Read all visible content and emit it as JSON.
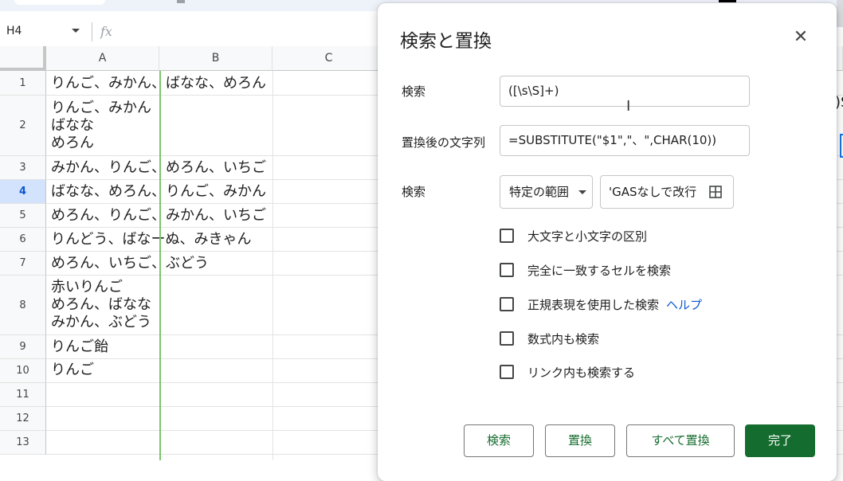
{
  "formula_bar": {
    "cell_ref": "H4",
    "fx_label": "fx"
  },
  "columns": [
    "A",
    "B",
    "C"
  ],
  "rows": [
    {
      "num": "1",
      "text": "りんご、みかん、ばなな、めろん"
    },
    {
      "num": "2",
      "text": "りんご、みかん\nばなな\nめろん"
    },
    {
      "num": "3",
      "text": "みかん、りんご、めろん、いちご"
    },
    {
      "num": "4",
      "text": "ばなな、めろん、りんご、みかん"
    },
    {
      "num": "5",
      "text": "めろん、りんご、みかん、いちご"
    },
    {
      "num": "6",
      "text": "りんどう、ばなーぬ、みきゃん"
    },
    {
      "num": "7",
      "text": "めろん、いちご、ぶどう"
    },
    {
      "num": "8",
      "text": "赤いりんご\nめろん、ばなな\nみかん、ぶどう"
    },
    {
      "num": "9",
      "text": "りんご飴"
    },
    {
      "num": "10",
      "text": "りんご"
    },
    {
      "num": "11",
      "text": ""
    },
    {
      "num": "12",
      "text": ""
    },
    {
      "num": "13",
      "text": ""
    }
  ],
  "offscreen_fragment": ")S",
  "dialog": {
    "title": "検索と置換",
    "find_label": "検索",
    "find_value": "([\\s\\S]+)",
    "replace_label": "置換後の文字列",
    "replace_value": "=SUBSTITUTE(\"$1\",\"、\",CHAR(10))",
    "scope_label": "検索",
    "scope_value": "特定の範囲",
    "range_value": "'GASなしで改行",
    "options": [
      {
        "label": "大文字と小文字の区別",
        "checked": false
      },
      {
        "label": "完全に一致するセルを検索",
        "checked": false
      },
      {
        "label": "正規表現を使用した検索",
        "checked": false,
        "link": "ヘルプ"
      },
      {
        "label": "数式内も検索",
        "checked": false
      },
      {
        "label": "リンク内も検索する",
        "checked": false
      }
    ],
    "buttons": {
      "find": "検索",
      "replace": "置換",
      "replace_all": "すべて置換",
      "done": "完了"
    },
    "accent_color": "#146c2e"
  }
}
